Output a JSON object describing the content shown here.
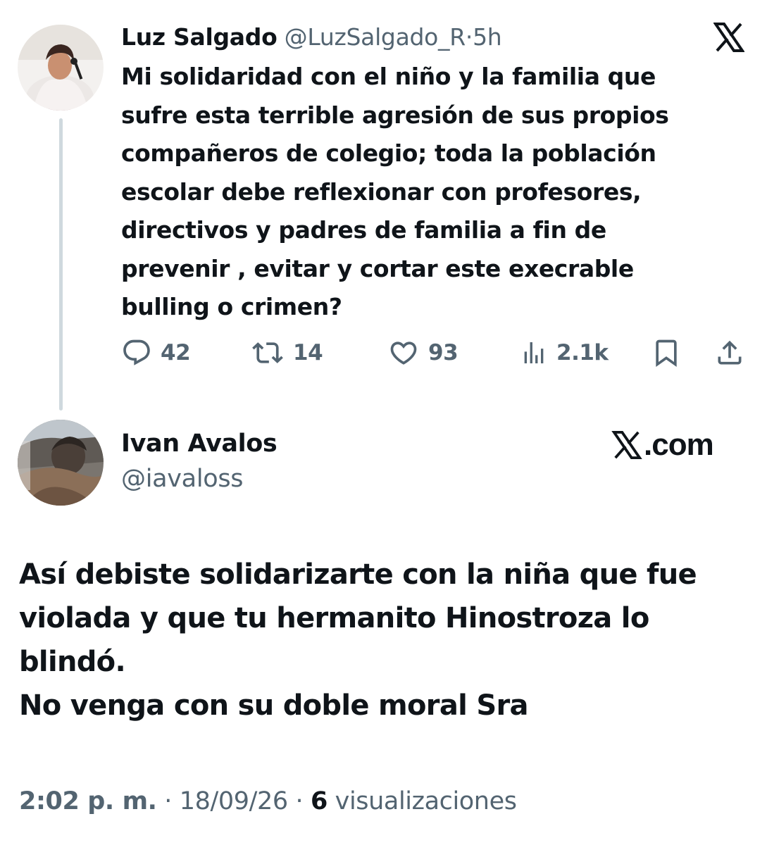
{
  "parent_tweet": {
    "author_name": "Luz Salgado",
    "handle": "@LuzSalgado_R",
    "separator": "·",
    "time": "5h",
    "text": "Mi solidaridad con el niño y la familia que\nsufre esta terrible agresión de sus propios\ncompañeros de colegio; toda la población\nescolar debe reflexionar con  profesores,\ndirectivos y padres de familia a fin de\nprevenir , evitar y cortar este execrable\nbulling o crimen?",
    "actions": {
      "replies": "42",
      "reposts": "14",
      "likes": "93",
      "views": "2.1k"
    },
    "icons": [
      "x-logo",
      "reply-icon",
      "repost-icon",
      "like-icon",
      "views-icon",
      "bookmark-icon",
      "share-icon"
    ]
  },
  "reply_tweet": {
    "author_name": "Ivan Avalos",
    "handle": "@iavaloss",
    "brand": ".com",
    "text": "Así debiste solidarizarte con la niña que fue\nviolada y que tu hermanito Hinostroza lo\nblindó.\nNo venga con su doble moral Sra",
    "timestamp_time": "2:02 p. m.",
    "timestamp_sep1": "·",
    "timestamp_date": "18/09/26",
    "timestamp_sep2": "·",
    "views_count": "6",
    "views_label": "visualizaciones"
  },
  "colors": {
    "text": "#0f1419",
    "muted": "#536471",
    "thread_line": "#cfd9de",
    "background": "#ffffff"
  }
}
